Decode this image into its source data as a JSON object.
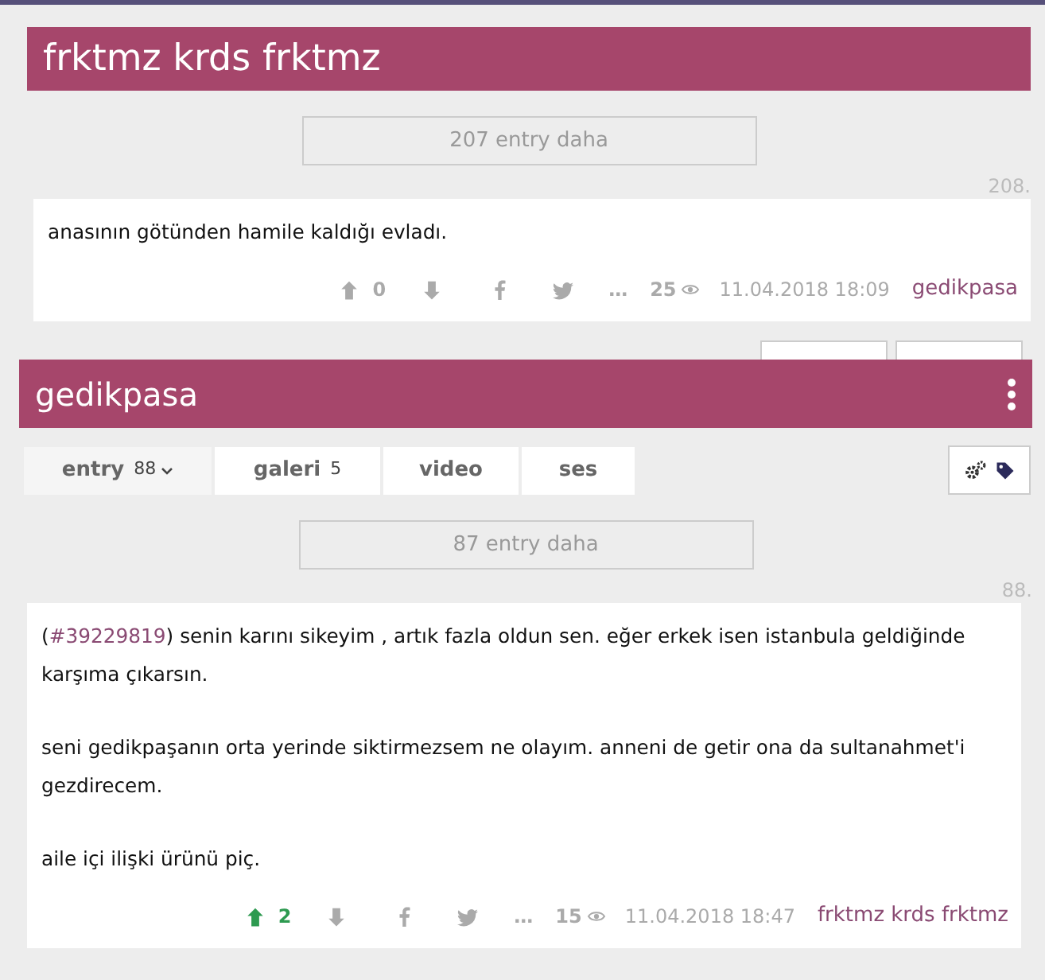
{
  "sections": [
    {
      "title": "frktmz krds frktmz",
      "menu": false,
      "more_button": "207 entry daha",
      "pager_below": true,
      "entries": [
        {
          "number": "208.",
          "paragraphs": [
            {
              "text": "anasının götünden hamile kaldığı evladı."
            }
          ],
          "upvotes": "0",
          "upvoted": false,
          "options": "…",
          "views": "25",
          "date": "11.04.2018 18:09",
          "author": "gedikpasa"
        }
      ]
    },
    {
      "title": "gedikpasa",
      "menu": true,
      "tabs": [
        {
          "label": "entry",
          "count": "88",
          "dropdown": true
        },
        {
          "label": "galeri",
          "count": "5",
          "dropdown": false
        },
        {
          "label": "video",
          "dropdown": false
        },
        {
          "label": "ses",
          "dropdown": false
        }
      ],
      "more_button": "87 entry daha",
      "entries": [
        {
          "number": "88.",
          "paragraphs": [
            {
              "before": "(",
              "link": "#39229819",
              "text": ") senin karını sikeyim , artık fazla oldun sen. eğer erkek isen istanbula geldiğinde karşıma çıkarsın."
            },
            {
              "text": "seni gedikpaşanın orta yerinde siktirmezsem ne olayım. anneni de getir ona da sultanahmet'i gezdirecem."
            },
            {
              "text": "aile içi ilişki ürünü piç."
            }
          ],
          "upvotes": "2",
          "upvoted": true,
          "options": "…",
          "views": "15",
          "date": "11.04.2018 18:47",
          "author": "frktmz krds frktmz"
        }
      ]
    }
  ]
}
